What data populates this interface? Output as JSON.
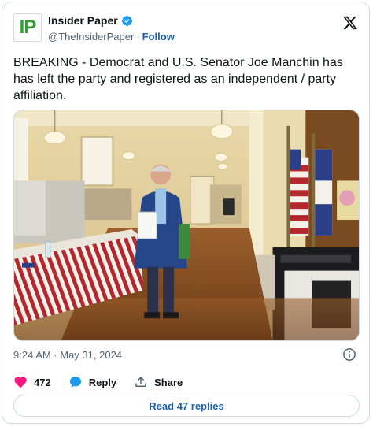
{
  "author": {
    "display_name": "Insider Paper",
    "handle": "@TheInsiderPaper",
    "separator": "·",
    "follow_label": "Follow",
    "logo_letters": "IP"
  },
  "tweet": {
    "text": "BREAKING - Democrat and U.S. Senator Joe Manchin has has left the party and registered as an independent / party affiliation.",
    "timestamp": "9:24 AM · May 31, 2024"
  },
  "engagement": {
    "likes": "472",
    "reply_label": "Reply",
    "share_label": "Share"
  },
  "read_replies_label": "Read 47 replies",
  "colors": {
    "accent": "#1d62a8",
    "verified": "#1d9bf0",
    "like": "#f91880",
    "logo_green": "#3a9b3a"
  },
  "icons": [
    "verified-badge-icon",
    "x-logo-icon",
    "info-icon",
    "heart-icon",
    "reply-bubble-icon",
    "share-icon"
  ]
}
